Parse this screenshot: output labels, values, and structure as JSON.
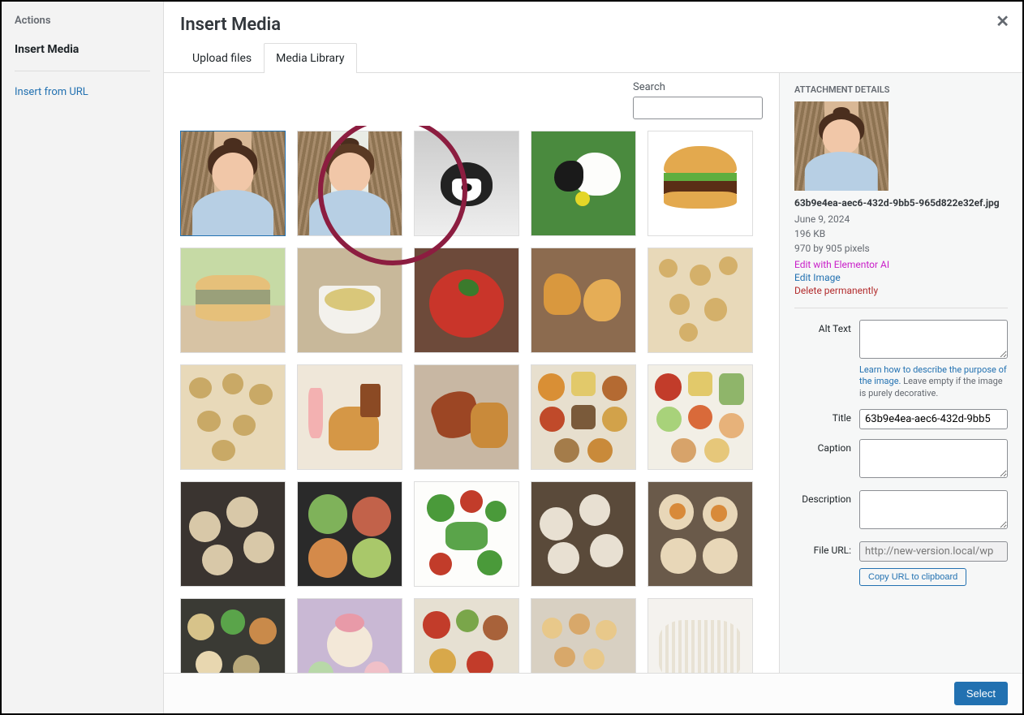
{
  "sidebar": {
    "heading": "Actions",
    "active_item": "Insert Media",
    "link": "Insert from URL"
  },
  "modal": {
    "title": "Insert Media"
  },
  "tabs": {
    "upload": "Upload files",
    "library": "Media Library"
  },
  "search": {
    "label": "Search",
    "value": ""
  },
  "details": {
    "heading": "ATTACHMENT DETAILS",
    "filename": "63b9e4ea-aec6-432d-9bb5-965d822e32ef.jpg",
    "date": "June 9, 2024",
    "size": "196 KB",
    "dimensions": "970 by 905 pixels",
    "edit_ai": "Edit with Elementor AI",
    "edit_image": "Edit Image",
    "delete": "Delete permanently",
    "alt_label": "Alt Text",
    "alt_value": "",
    "alt_help_link": "Learn how to describe the purpose of the image.",
    "alt_help_rest": " Leave empty if the image is purely decorative.",
    "title_label": "Title",
    "title_value": "63b9e4ea-aec6-432d-9bb5",
    "caption_label": "Caption",
    "caption_value": "",
    "description_label": "Description",
    "description_value": "",
    "fileurl_label": "File URL:",
    "fileurl_value": "http://new-version.local/wp",
    "copy_label": "Copy URL to clipboard"
  },
  "footer": {
    "select": "Select"
  }
}
